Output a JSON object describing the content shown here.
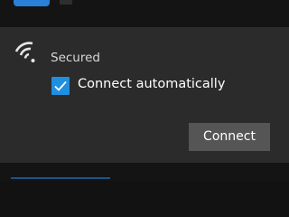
{
  "network": {
    "status": "Secured",
    "connect_automatically": {
      "label": "Connect automatically",
      "checked": true
    },
    "connect_button_label": "Connect",
    "icons": {
      "signal": "wifi-signal-icon",
      "check": "checkmark-icon"
    }
  },
  "colors": {
    "accent": "#1f8fe0",
    "panel": "#2b2b2b",
    "button": "#555555"
  }
}
